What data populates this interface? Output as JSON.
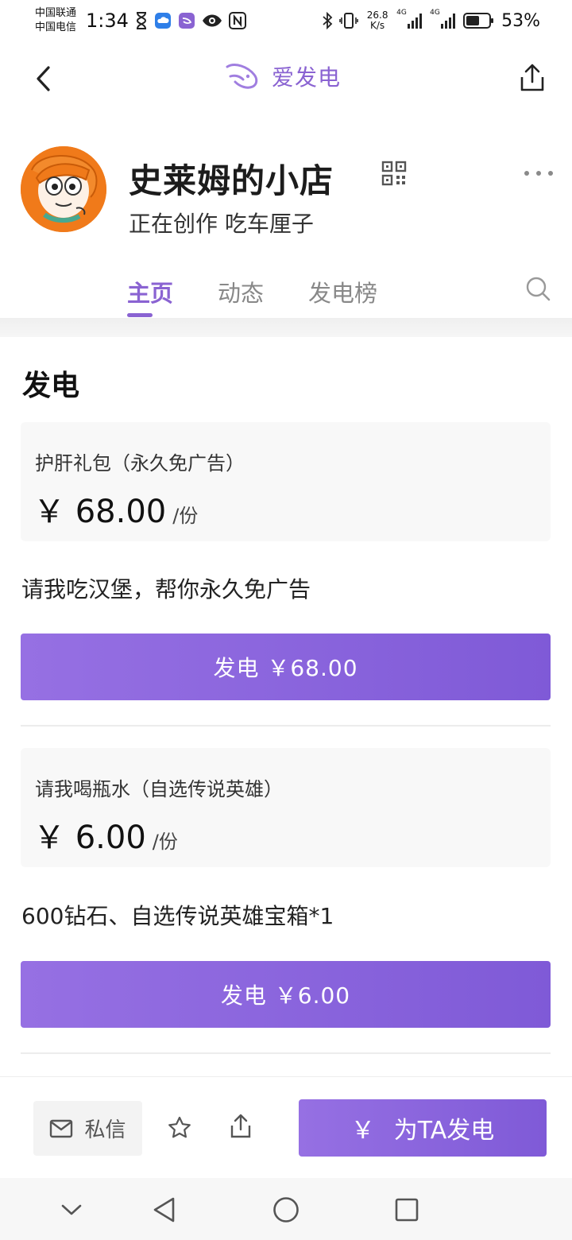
{
  "status_bar": {
    "carrier_1": "中国联通",
    "carrier_2": "中国电信",
    "time": "1:34",
    "net_speed_value": "26.8",
    "net_speed_unit": "K/s",
    "signal_1_label": "4G",
    "signal_2_label": "4G",
    "battery": "53%",
    "icons": [
      "hourglass-icon",
      "cloud-icon",
      "app-icon",
      "eye-icon",
      "nfc-icon",
      "bluetooth-icon",
      "vibrate-icon",
      "signal-icon",
      "battery-icon"
    ]
  },
  "header": {
    "brand": "爱发电",
    "brand_color": "#8a63d2",
    "icons": [
      "back-icon",
      "brand-logo-icon",
      "share-icon"
    ]
  },
  "profile": {
    "shop_name": "史莱姆的小店",
    "status": "正在创作 吃车厘子",
    "icons": [
      "avatar",
      "qr-code-icon",
      "more-icon"
    ]
  },
  "tabs": [
    {
      "label": "主页",
      "active": true
    },
    {
      "label": "动态",
      "active": false
    },
    {
      "label": "发电榜",
      "active": false
    }
  ],
  "section_title": "发电",
  "tiers": [
    {
      "name": "护肝礼包（永久免广告）",
      "price": "￥ 68.00",
      "unit": "/份",
      "description": "请我吃汉堡，帮你永久免广告",
      "button": "发电 ￥68.00"
    },
    {
      "name": "请我喝瓶水（自选传说英雄）",
      "price": "￥ 6.00",
      "unit": "/份",
      "description": "600钻石、自选传说英雄宝箱*1",
      "button": "发电 ￥6.00"
    }
  ],
  "action_bar": {
    "message_label": "私信",
    "support_label": "为TA发电",
    "support_symbol": "￥",
    "icons": [
      "mail-icon",
      "star-icon",
      "share-icon"
    ]
  },
  "accent_color": "#8a63d2",
  "system_nav": [
    "chevron-down-icon",
    "back-triangle-icon",
    "home-circle-icon",
    "recents-square-icon"
  ]
}
